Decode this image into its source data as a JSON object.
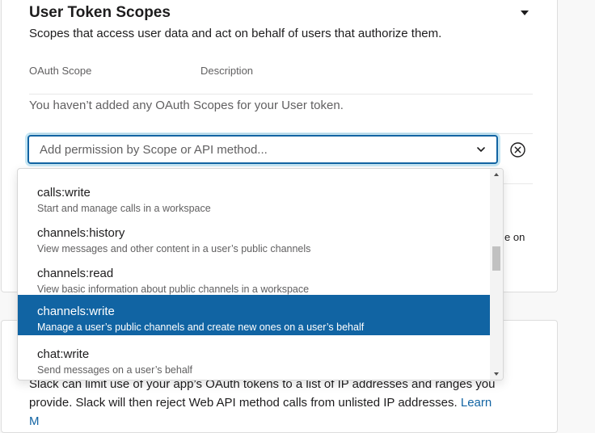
{
  "section": {
    "title": "User Token Scopes",
    "subtitle": "Scopes that access user data and act on behalf of users that authorize them.",
    "columns": {
      "scope": "OAuth Scope",
      "description": "Description"
    },
    "empty_message": "You haven’t added any OAuth Scopes for your User token."
  },
  "select": {
    "placeholder": "Add permission by Scope or API method..."
  },
  "background_partial_text": "e on",
  "options": [
    {
      "name": "calls:write",
      "description": "Start and manage calls in a workspace"
    },
    {
      "name": "channels:history",
      "description": "View messages and other content in a user’s public channels"
    },
    {
      "name": "channels:read",
      "description": "View basic information about public channels in a workspace"
    },
    {
      "name": "channels:write",
      "description": "Manage a user’s public channels and create new ones on a user’s behalf",
      "selected": true
    },
    {
      "name": "chat:write",
      "description": "Send messages on a user’s behalf"
    }
  ],
  "ip_section": {
    "line1": "Slack can limit use of your app’s OAuth tokens to a list of IP addresses and ranges you",
    "line2": "provide. Slack will then reject Web API method calls from unlisted IP addresses.",
    "learn_link": "Learn",
    "line3": "M"
  },
  "colors": {
    "accent": "#1264a3",
    "selected_bg": "#1164a3"
  },
  "icons": [
    "caret-down-icon",
    "chevron-down-icon",
    "close-circle-icon"
  ]
}
